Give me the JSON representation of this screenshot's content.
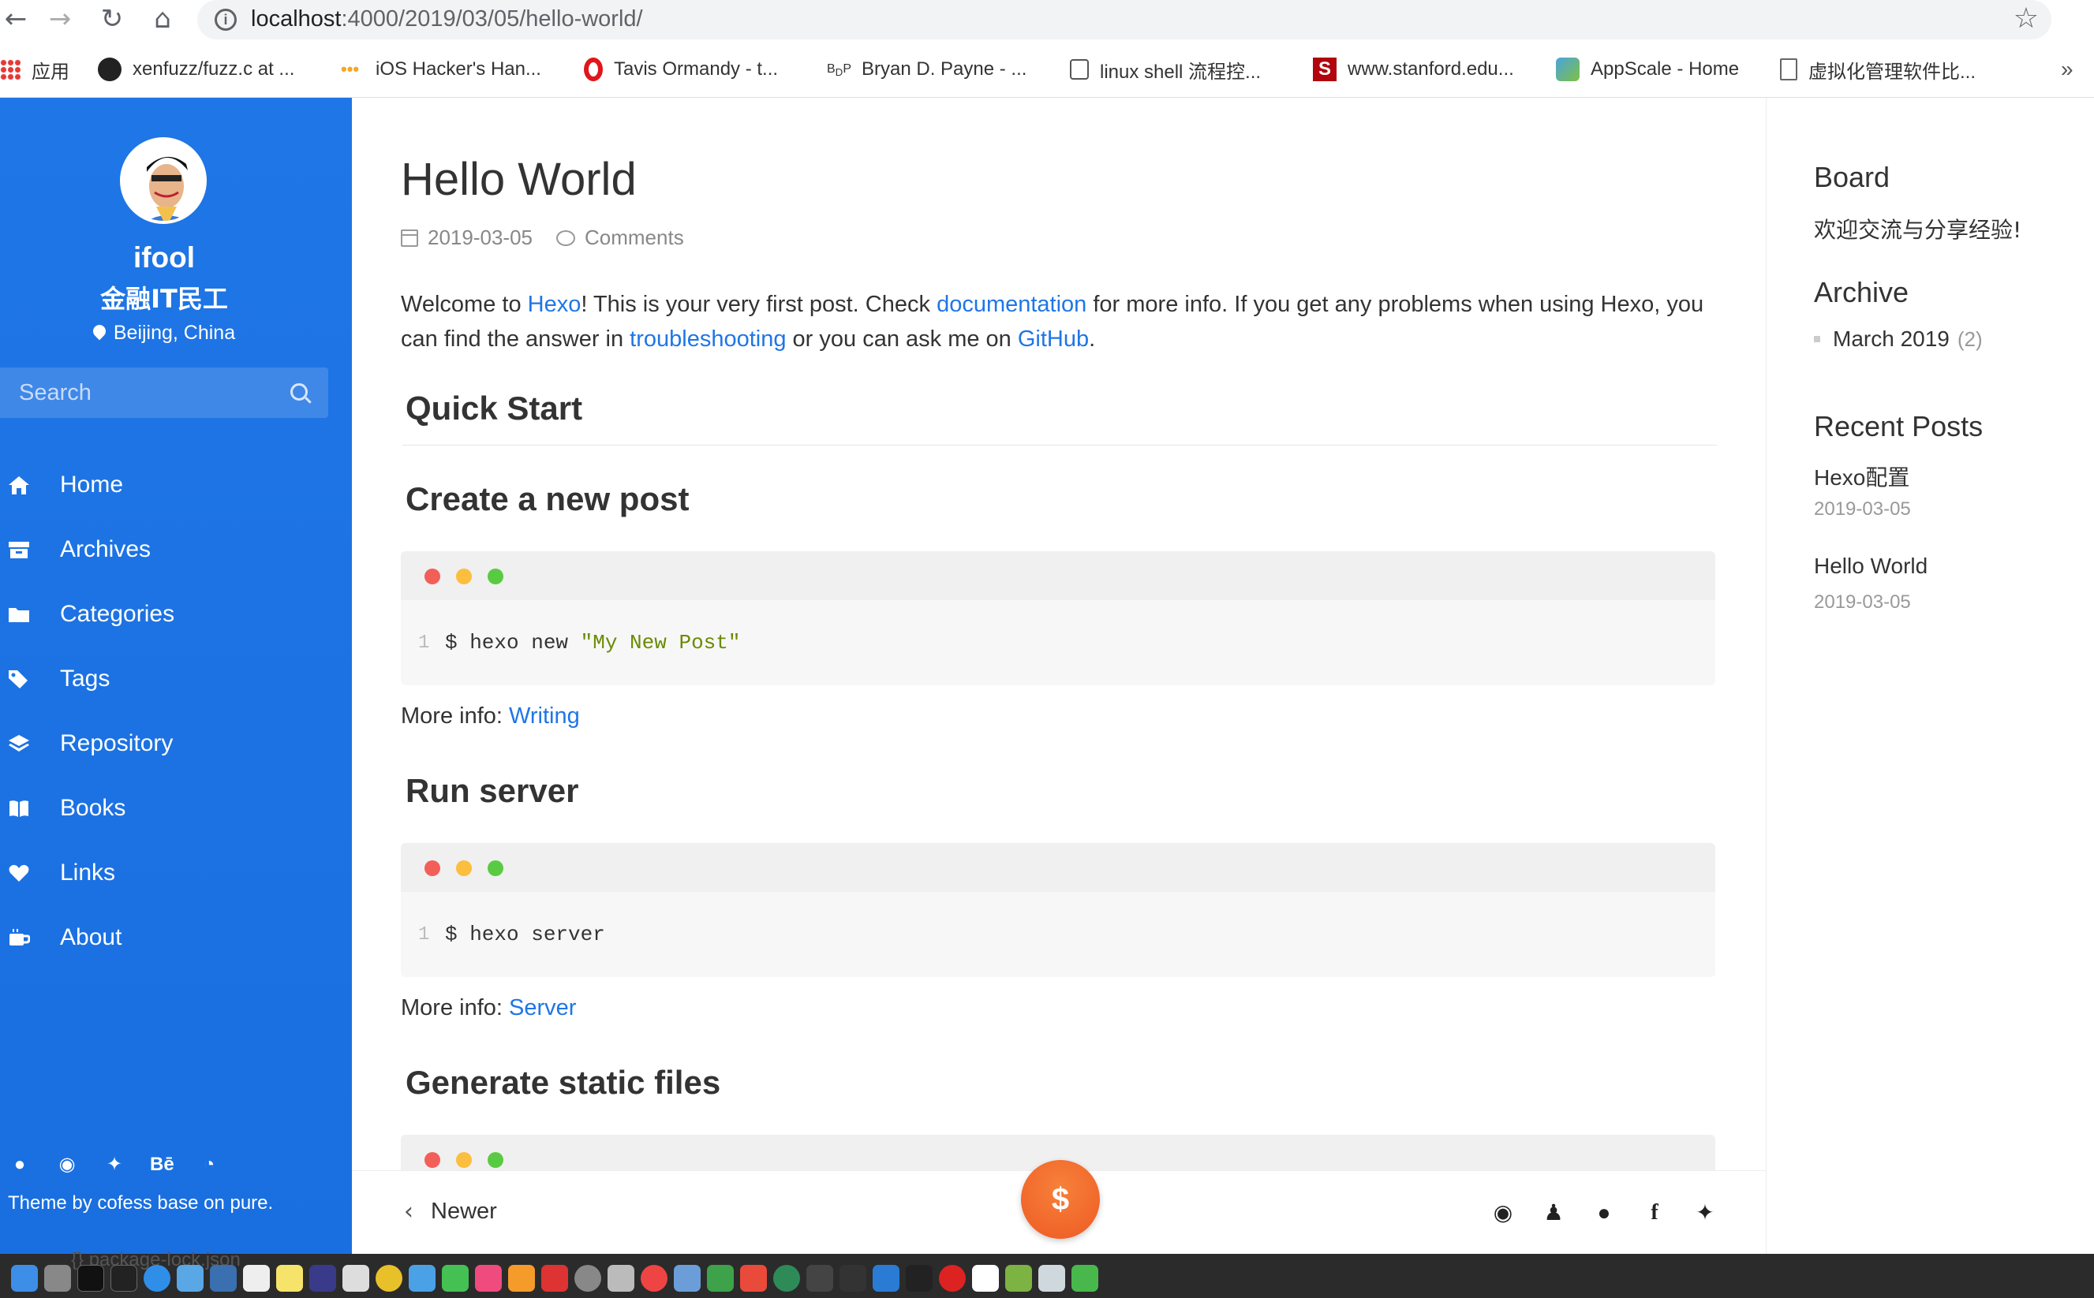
{
  "browser": {
    "url_host": "localhost",
    "url_path": ":4000/2019/03/05/hello-world/",
    "bookmarks": [
      {
        "label": "应用"
      },
      {
        "label": "xenfuzz/fuzz.c at ..."
      },
      {
        "label": "iOS Hacker's Han..."
      },
      {
        "label": "Tavis Ormandy - t..."
      },
      {
        "label": "Bryan D. Payne - ..."
      },
      {
        "label": "linux shell 流程控..."
      },
      {
        "label": "www.stanford.edu..."
      },
      {
        "label": "AppScale - Home"
      },
      {
        "label": "虚拟化管理软件比..."
      }
    ],
    "more_label": "»"
  },
  "sidebar": {
    "name": "ifool",
    "subtitle": "金融IT民工",
    "location": "Beijing, China",
    "search_placeholder": "Search",
    "menu": [
      {
        "label": "Home",
        "icon": "home-icon"
      },
      {
        "label": "Archives",
        "icon": "archive-icon"
      },
      {
        "label": "Categories",
        "icon": "folder-icon"
      },
      {
        "label": "Tags",
        "icon": "tag-icon"
      },
      {
        "label": "Repository",
        "icon": "layers-icon"
      },
      {
        "label": "Books",
        "icon": "book-icon"
      },
      {
        "label": "Links",
        "icon": "heart-icon"
      },
      {
        "label": "About",
        "icon": "coffee-icon"
      }
    ],
    "social_icons": [
      "github-icon",
      "weibo-icon",
      "twitter-icon",
      "behance-icon",
      "rss-icon"
    ],
    "credit": "Theme by cofess base on pure."
  },
  "post": {
    "title": "Hello World",
    "date": "2019-03-05",
    "comments_label": "Comments",
    "intro": {
      "p1": "Welcome to ",
      "link_hexo": "Hexo",
      "p2": "! This is your very first post. Check ",
      "link_docs": "documentation",
      "p3": " for more info. If you get any problems when using Hexo, you can find the answer in ",
      "link_trouble": "troubleshooting",
      "p4": " or you can ask me on ",
      "link_github": "GitHub",
      "p5": "."
    },
    "h_quick_start": "Quick Start",
    "sections": [
      {
        "heading": "Create a new post",
        "line_no": "1",
        "cmd": "$ hexo new ",
        "str": "\"My New Post\"",
        "more_prefix": "More info: ",
        "more_link": "Writing"
      },
      {
        "heading": "Run server",
        "line_no": "1",
        "cmd": "$ hexo server",
        "str": "",
        "more_prefix": "More info: ",
        "more_link": "Server"
      },
      {
        "heading": "Generate static files"
      }
    ],
    "newer_label": "Newer",
    "donate_label": "$",
    "share_icons": [
      "weibo-icon",
      "qq-icon",
      "wechat-icon",
      "facebook-icon",
      "twitter-icon"
    ]
  },
  "aside": {
    "board_title": "Board",
    "board_text": "欢迎交流与分享经验!",
    "archive_title": "Archive",
    "archive_item": "March 2019",
    "archive_count": "(2)",
    "recent_title": "Recent Posts",
    "recent": [
      {
        "title": "Hexo配置",
        "date": "2019-03-05"
      },
      {
        "title": "Hello World",
        "date": "2019-03-05"
      }
    ]
  },
  "dock": {
    "bg_text": "{} package-lock.json"
  },
  "colors": {
    "accent": "#1f76e6",
    "dot_red": "#f25f58",
    "dot_yellow": "#fbbe3e",
    "dot_green": "#58cb42",
    "donate": "#ee5a24"
  }
}
